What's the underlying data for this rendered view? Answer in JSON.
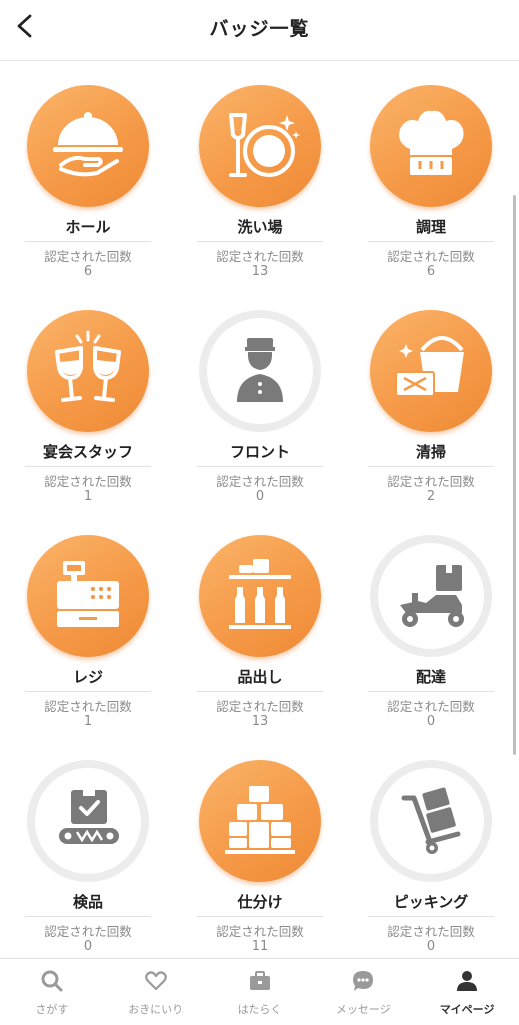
{
  "header": {
    "title": "バッジ一覧"
  },
  "badges": [
    {
      "name": "ホール",
      "label": "認定された回数",
      "count": "6",
      "icon": "cloche-icon"
    },
    {
      "name": "洗い場",
      "label": "認定された回数",
      "count": "13",
      "icon": "clean-dishes-icon"
    },
    {
      "name": "調理",
      "label": "認定された回数",
      "count": "6",
      "icon": "chef-hat-icon"
    },
    {
      "name": "宴会スタッフ",
      "label": "認定された回数",
      "count": "1",
      "icon": "toast-glasses-icon"
    },
    {
      "name": "フロント",
      "label": "認定された回数",
      "count": "0",
      "icon": "bellhop-icon"
    },
    {
      "name": "清掃",
      "label": "認定された回数",
      "count": "2",
      "icon": "bucket-icon"
    },
    {
      "name": "レジ",
      "label": "認定された回数",
      "count": "1",
      "icon": "cash-register-icon"
    },
    {
      "name": "品出し",
      "label": "認定された回数",
      "count": "13",
      "icon": "shelf-stocking-icon"
    },
    {
      "name": "配達",
      "label": "認定された回数",
      "count": "0",
      "icon": "delivery-scooter-icon"
    },
    {
      "name": "検品",
      "label": "認定された回数",
      "count": "0",
      "icon": "inspection-conveyor-icon"
    },
    {
      "name": "仕分け",
      "label": "認定された回数",
      "count": "11",
      "icon": "boxes-icon"
    },
    {
      "name": "ピッキング",
      "label": "認定された回数",
      "count": "0",
      "icon": "hand-truck-icon"
    }
  ],
  "tabbar": {
    "items": [
      {
        "label": "さがす",
        "icon": "search-icon"
      },
      {
        "label": "おきにいり",
        "icon": "heart-icon"
      },
      {
        "label": "はたらく",
        "icon": "briefcase-icon"
      },
      {
        "label": "メッセージ",
        "icon": "chat-icon"
      },
      {
        "label": "マイページ",
        "icon": "person-icon"
      }
    ]
  },
  "colors": {
    "badge_active": "#f59a48",
    "badge_inactive_ring": "#ececec",
    "icon_inactive": "#7a7a7a"
  }
}
